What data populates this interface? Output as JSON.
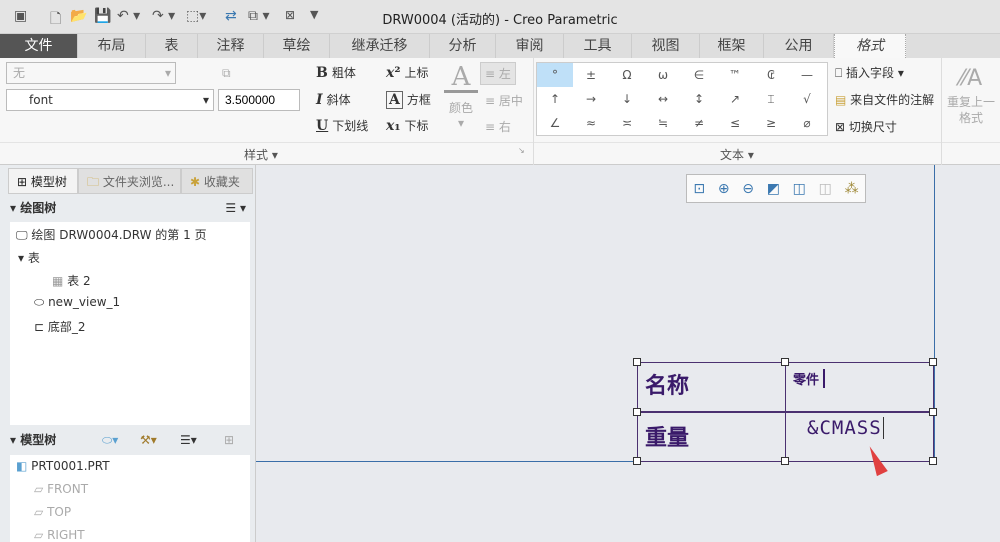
{
  "window": {
    "title": "DRW0004 (活动的) - Creo Parametric"
  },
  "quick_access": [
    "app-icon",
    "new-icon",
    "open-icon",
    "save-icon",
    "undo-icon",
    "redo-icon",
    "select-box-icon",
    "regenerate-icon",
    "window-icon",
    "close-window-icon",
    "customize-icon"
  ],
  "tabs": [
    {
      "label": "文件"
    },
    {
      "label": "布局"
    },
    {
      "label": "表"
    },
    {
      "label": "注释"
    },
    {
      "label": "草绘"
    },
    {
      "label": "继承迁移"
    },
    {
      "label": "分析"
    },
    {
      "label": "审阅"
    },
    {
      "label": "工具"
    },
    {
      "label": "视图"
    },
    {
      "label": "框架"
    },
    {
      "label": "公用"
    },
    {
      "label": "格式"
    }
  ],
  "ribbon": {
    "style_select": "无",
    "font_select": "font",
    "height_input": "3.500000",
    "bold": "粗体",
    "italic": "斜体",
    "underline": "下划线",
    "superscript": "上标",
    "box": "方框",
    "subscript": "下标",
    "color": "颜色",
    "align_left": "左",
    "align_center": "居中",
    "align_right": "右",
    "style_group": "样式",
    "text_group": "文本",
    "symbols": [
      "°",
      "±",
      "Ω",
      "ω",
      "∈",
      "™",
      "₢",
      "—",
      "↑",
      "→",
      "↓",
      "↔",
      "↕",
      "↗",
      "⌶",
      "√",
      "∠",
      "≈",
      "≍",
      "≒",
      "≠",
      "≤",
      "≥",
      "⌀"
    ],
    "insert_field": "插入字段",
    "note_from_file": "来自文件的注解",
    "toggle_dim": "切换尺寸",
    "repeat_format": "重复上一格式"
  },
  "left_panel": {
    "tabs": [
      "模型树",
      "文件夹浏览...",
      "收藏夹"
    ],
    "drawing_tree_header": "绘图树",
    "drawing_tree": [
      "绘图 DRW0004.DRW 的第 1 页",
      "表",
      "表 2",
      "new_view_1",
      "底部_2"
    ],
    "model_tree_header": "模型树",
    "model_tree": [
      "PRT0001.PRT",
      "FRONT",
      "TOP",
      "RIGHT"
    ]
  },
  "canvas": {
    "table": {
      "r1c1": "名称",
      "r1c2": "零件",
      "r2c1": "重量",
      "r2c2": "&CMASS"
    }
  }
}
